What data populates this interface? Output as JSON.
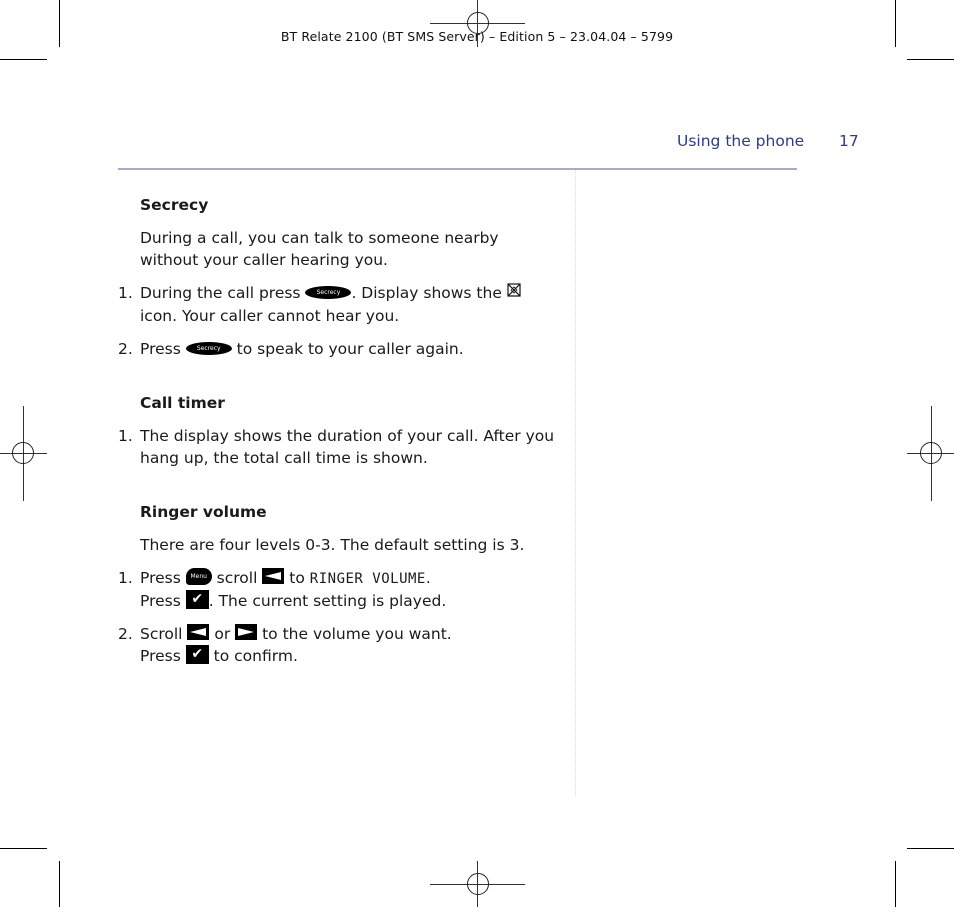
{
  "slug": "BT Relate 2100 (BT SMS Server) – Edition 5 – 23.04.04 – 5799",
  "header": {
    "section_name": "Using the phone",
    "page_number": "17",
    "accent_color": "#2d3a8c",
    "rule_color": "#a9a9cf"
  },
  "secrecy": {
    "title": "Secrecy",
    "intro": "During a call, you can talk to someone nearby without your caller hearing you.",
    "steps": [
      {
        "num": "1.",
        "before_button": "During the call press",
        "button_label": "Secrecy",
        "after_button": ". Display shows the",
        "icon": "secrecy-mute-icon",
        "after_icon": "icon. Your caller cannot hear you."
      },
      {
        "num": "2.",
        "before_button": "Press",
        "button_label": "Secrecy",
        "after_button": "to speak to your caller again."
      }
    ]
  },
  "call_timer": {
    "title": "Call timer",
    "steps": [
      {
        "num": "1.",
        "text": "The display shows the duration of your call. After you hang up, the total call time is shown."
      }
    ]
  },
  "ringer_volume": {
    "title": "Ringer volume",
    "intro": "There are four levels 0-3. The default setting is 3.",
    "steps": [
      {
        "num": "1.",
        "press": "Press",
        "menu_label": "Menu",
        "scroll": "scroll",
        "to": "to",
        "display_text": "RINGER VOLUME",
        "period": ".",
        "press2": "Press",
        "after_ok": ". The current setting is played."
      },
      {
        "num": "2.",
        "scroll": "Scroll",
        "or": "or",
        "after_scroll": "to the volume you want.",
        "press": "Press",
        "after_ok": "to confirm."
      }
    ]
  }
}
